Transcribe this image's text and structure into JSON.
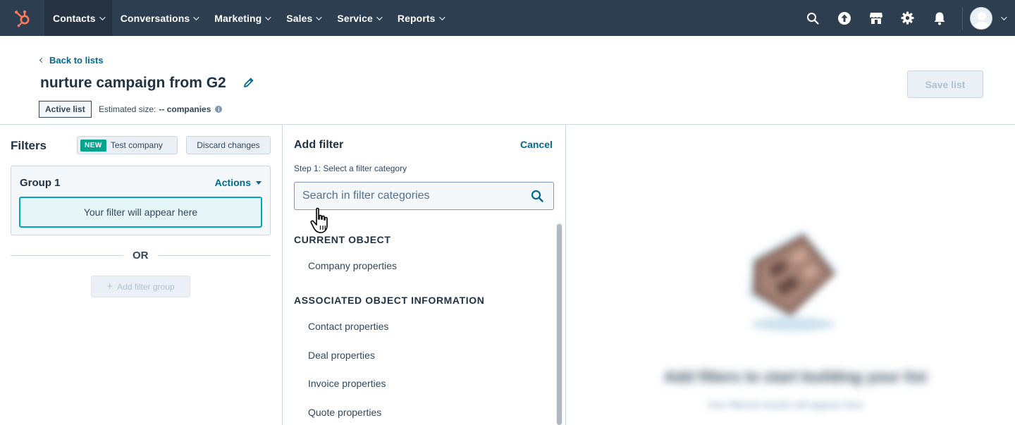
{
  "nav": {
    "items": [
      {
        "label": "Contacts",
        "active": true
      },
      {
        "label": "Conversations",
        "active": false
      },
      {
        "label": "Marketing",
        "active": false
      },
      {
        "label": "Sales",
        "active": false
      },
      {
        "label": "Service",
        "active": false
      },
      {
        "label": "Reports",
        "active": false
      }
    ],
    "icons": [
      "search-icon",
      "upgrade-icon",
      "marketplace-icon",
      "settings-icon",
      "notifications-icon"
    ]
  },
  "header": {
    "back_label": "Back to lists",
    "title": "nurture campaign from G2",
    "save_label": "Save list",
    "list_type": "Active list",
    "estimated_label": "Estimated size:",
    "estimated_value": "-- companies"
  },
  "filters": {
    "title": "Filters",
    "new_badge": "NEW",
    "test_company_label": "Test company",
    "discard_label": "Discard changes",
    "group_title": "Group 1",
    "actions_label": "Actions",
    "placeholder": "Your filter will appear here",
    "or_label": "OR",
    "add_group_label": "Add filter group"
  },
  "add_filter": {
    "title": "Add filter",
    "cancel_label": "Cancel",
    "step": "Step 1: Select a filter category",
    "search_placeholder": "Search in filter categories",
    "sections": [
      {
        "heading": "CURRENT OBJECT",
        "items": [
          "Company properties"
        ]
      },
      {
        "heading": "ASSOCIATED OBJECT INFORMATION",
        "items": [
          "Contact properties",
          "Deal properties",
          "Invoice properties",
          "Quote properties"
        ]
      }
    ]
  },
  "empty_state": {
    "title": "Add filters to start building your list",
    "subtitle": "Your filtered results will appear here"
  },
  "colors": {
    "nav_bg": "#2d3e50",
    "accent": "#00698f",
    "highlight": "#00a4bd",
    "new_badge": "#00a38d",
    "logo": "#ff7a59"
  }
}
